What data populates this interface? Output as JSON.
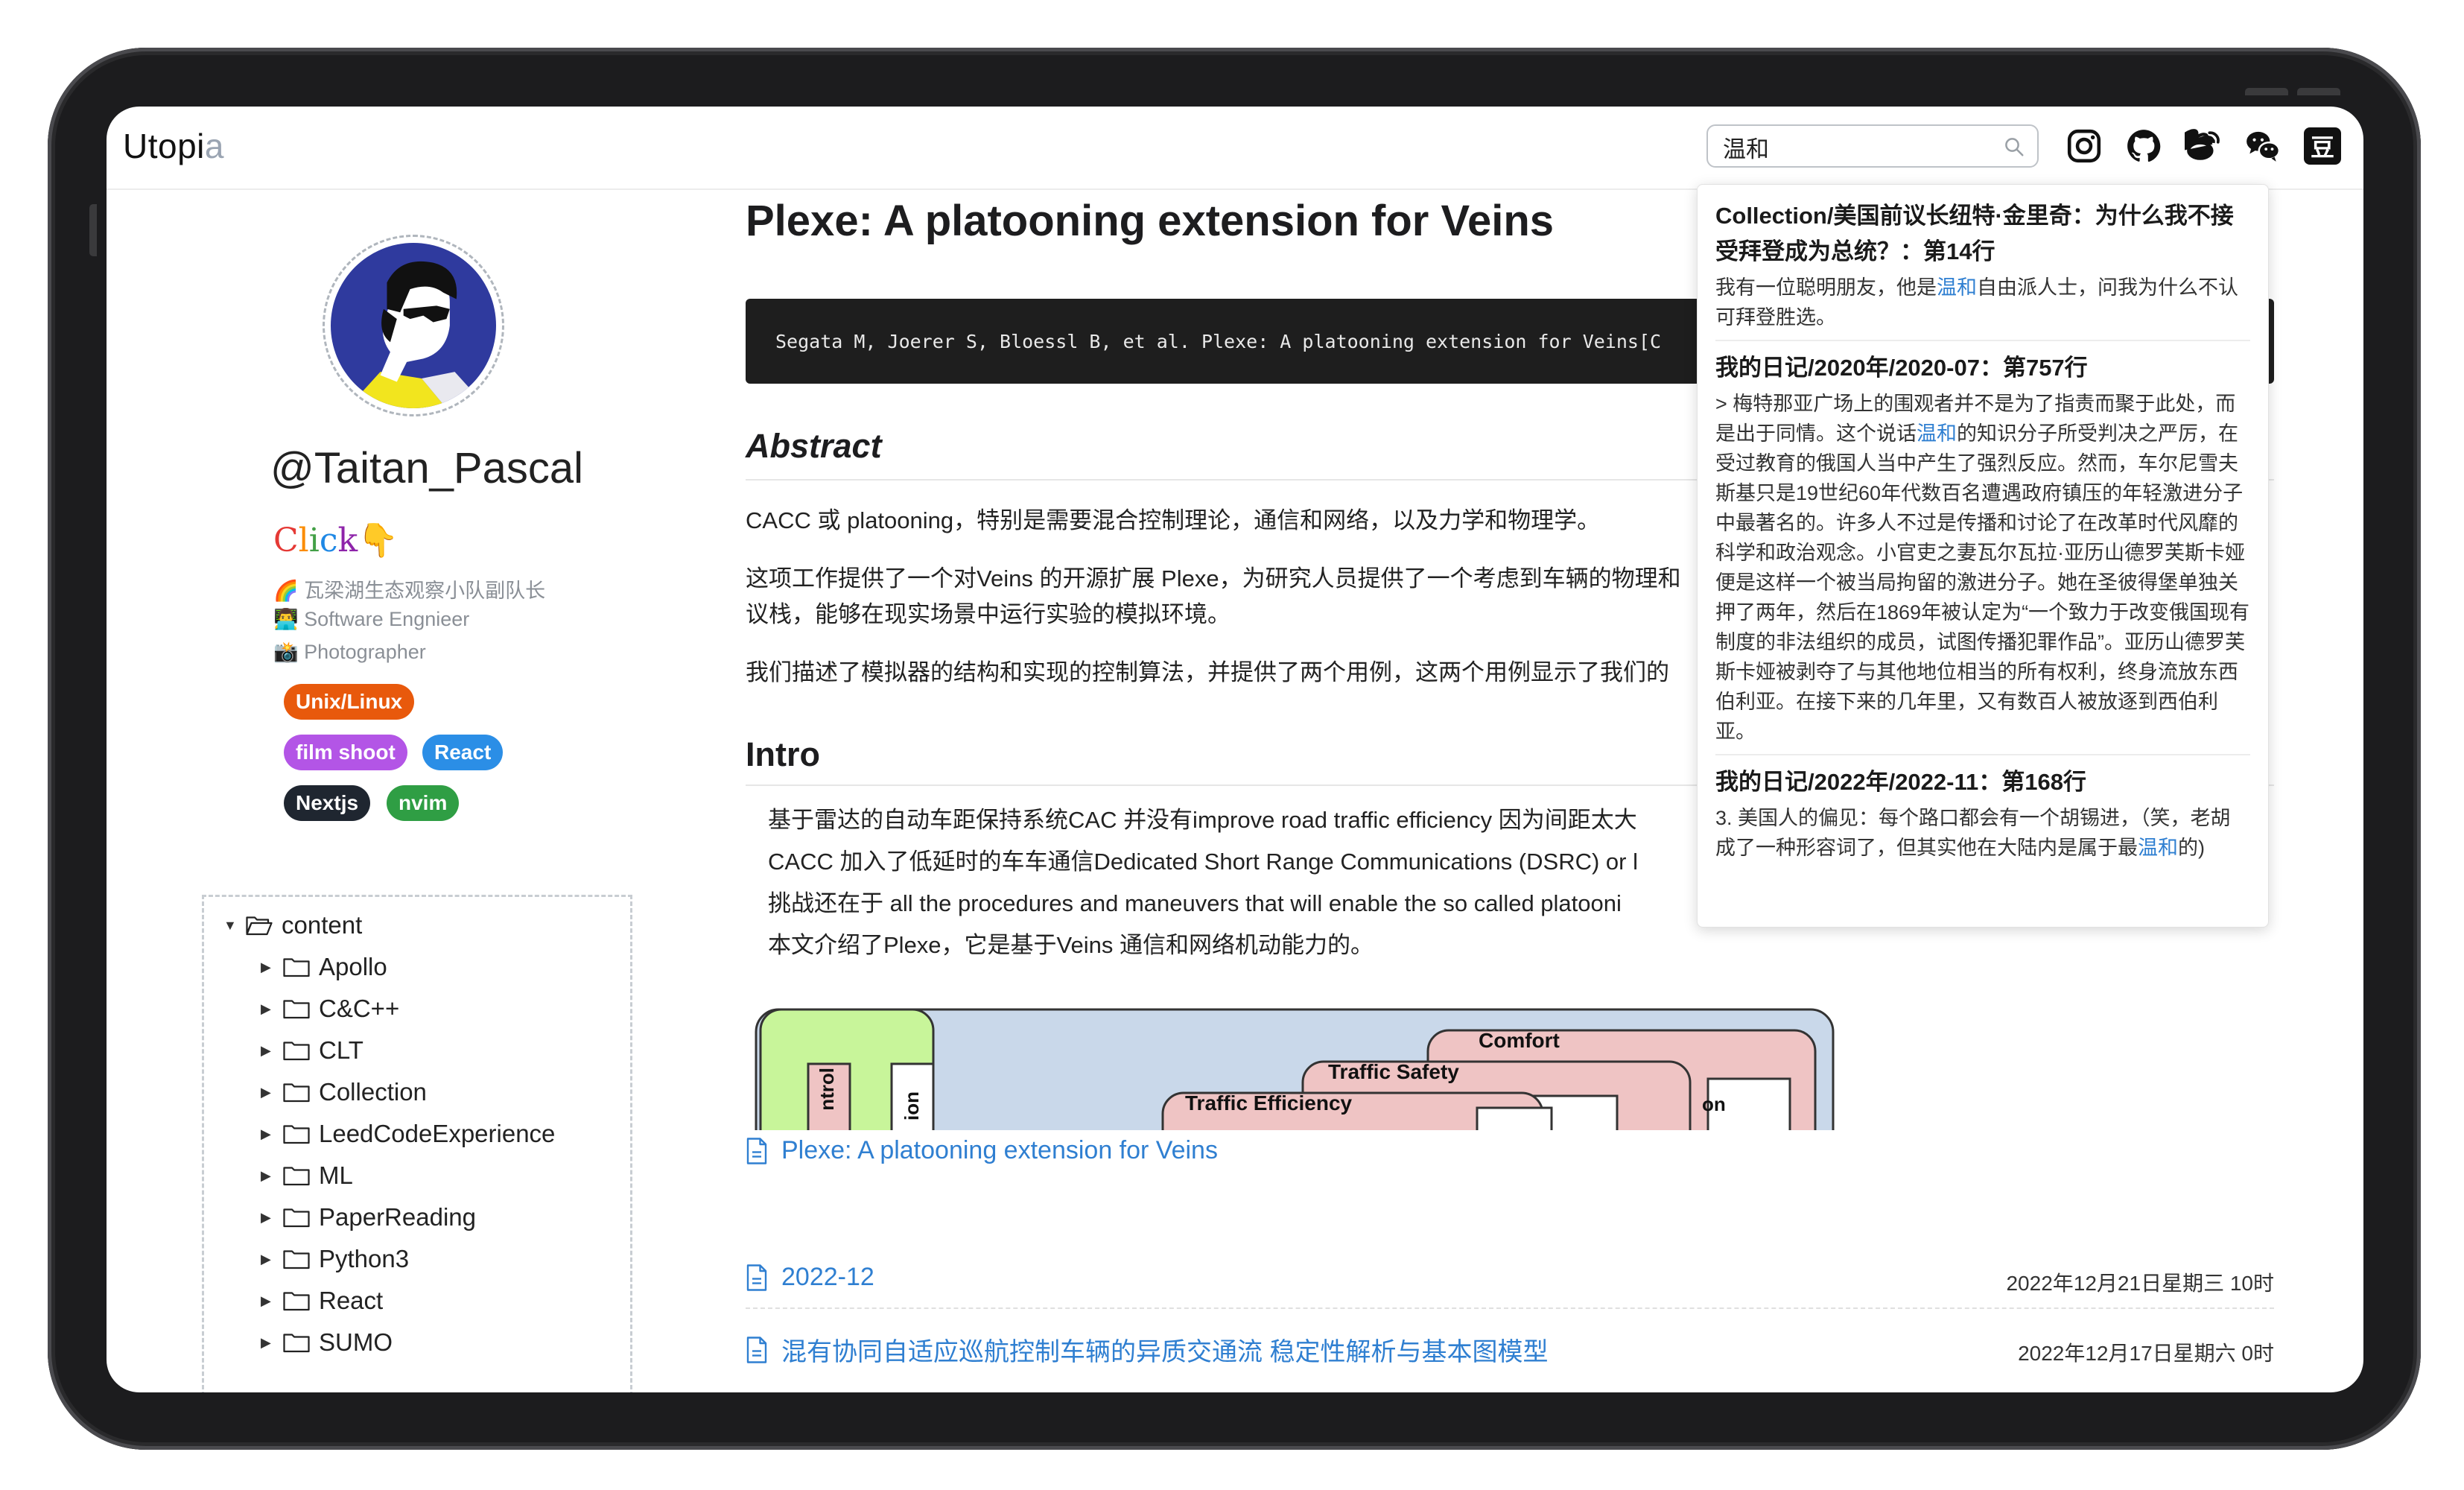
{
  "header": {
    "logo_main": "Utopi",
    "logo_fade": "a",
    "search_value": "温和",
    "douban_label": "豆"
  },
  "profile": {
    "username": "@Taitan_Pascal",
    "click": [
      "C",
      "l",
      "i",
      "c",
      "k"
    ],
    "click_emoji": "👇",
    "bio": [
      "🌈 瓦梁湖生态观察小队副队长",
      "👨‍💻 Software Engnieer",
      "📸 Photographer"
    ],
    "tags": [
      {
        "label": "Unix/Linux",
        "color": "#e8590c"
      },
      {
        "label": "film shoot",
        "color": "#b355e6"
      },
      {
        "label": "React",
        "color": "#2b8ee6"
      },
      {
        "label": "Nextjs",
        "color": "#1f2630"
      },
      {
        "label": "nvim",
        "color": "#2f9e44"
      }
    ]
  },
  "tree": {
    "root": "content",
    "items": [
      "Apollo",
      "C&C++",
      "CLT",
      "Collection",
      "LeedCodeExperience",
      "ML",
      "PaperReading",
      "Python3",
      "React",
      "SUMO"
    ]
  },
  "article": {
    "title": "Plexe: A platooning extension for Veins",
    "citation": "Segata M, Joerer S, Bloessl B, et al. Plexe: A platooning extension for Veins[C",
    "abstract_heading": "Abstract",
    "abstract_p1": "CACC 或 platooning，特别是需要混合控制理论，通信和网络，以及力学和物理学。",
    "abstract_p2a": "这项工作提供了一个对Veins 的开源扩展 Plexe，为研究人员提供了一个考虑到车辆的物理和",
    "abstract_p2b": "议栈，能够在现实场景中运行实验的模拟环境。",
    "abstract_p3": "我们描述了模拟器的结构和实现的控制算法，并提供了两个用例，这两个用例显示了我们的",
    "intro_heading": "Intro",
    "bullets": [
      "基于雷达的自动车距保持系统CAC 并没有improve road traffic efficiency 因为间距太大",
      "CACC 加入了低延时的车车通信Dedicated Short Range Communications (DSRC) or l",
      "挑战还在于 all the procedures and maneuvers that will enable the so called platooni",
      "本文介绍了Plexe，它是基于Veins 通信和网络机动能力的。"
    ],
    "figure_labels": {
      "comfort": "Comfort",
      "safety": "Traffic Safety",
      "efficiency": "Traffic Efficiency",
      "ntrol": "ntrol",
      "ion": "ion",
      "on": "on"
    },
    "page_link": "Plexe: A platooning extension for Veins"
  },
  "posts": [
    {
      "title": "2022-12",
      "date": "2022年12月21日星期三 10时"
    },
    {
      "title": "混有协同自适应巡航控制车辆的异质交通流 稳定性解析与基本图模型",
      "date": "2022年12月17日星期六 0时"
    }
  ],
  "search_results": [
    {
      "title": "Collection/美国前议长纽特·金里奇：为什么我不接受拜登成为总统？：第14行",
      "before": "我有一位聪明朋友，他是",
      "match": "温和",
      "after": "自由派人士，问我为什么不认可拜登胜选。"
    },
    {
      "title": "我的日记/2020年/2020-07：第757行",
      "before": "> 梅特那亚广场上的围观者并不是为了指责而聚于此处，而是出于同情。这个说话",
      "match": "温和",
      "after": "的知识分子所受判决之严厉，在受过教育的俄国人当中产生了强烈反应。然而，车尔尼雪夫斯基只是19世纪60年代数百名遭遇政府镇压的年轻激进分子中最著名的。许多人不过是传播和讨论了在改革时代风靡的科学和政治观念。小官吏之妻瓦尔瓦拉·亚历山德罗芙斯卡娅便是这样一个被当局拘留的激进分子。她在圣彼得堡单独关押了两年，然后在1869年被认定为“一个致力于改变俄国现有制度的非法组织的成员，试图传播犯罪作品”。亚历山德罗芙斯卡娅被剥夺了与其他地位相当的所有权利，终身流放东西伯利亚。在接下来的几年里，又有数百人被放逐到西伯利亚。"
    },
    {
      "title": "我的日记/2022年/2022-11：第168行",
      "before": "3. 美国人的偏见：每个路口都会有一个胡锡进，（笑，老胡成了一种形容词了，但其实他在大陆内是属于最",
      "match": "温和",
      "after": "的)"
    }
  ]
}
